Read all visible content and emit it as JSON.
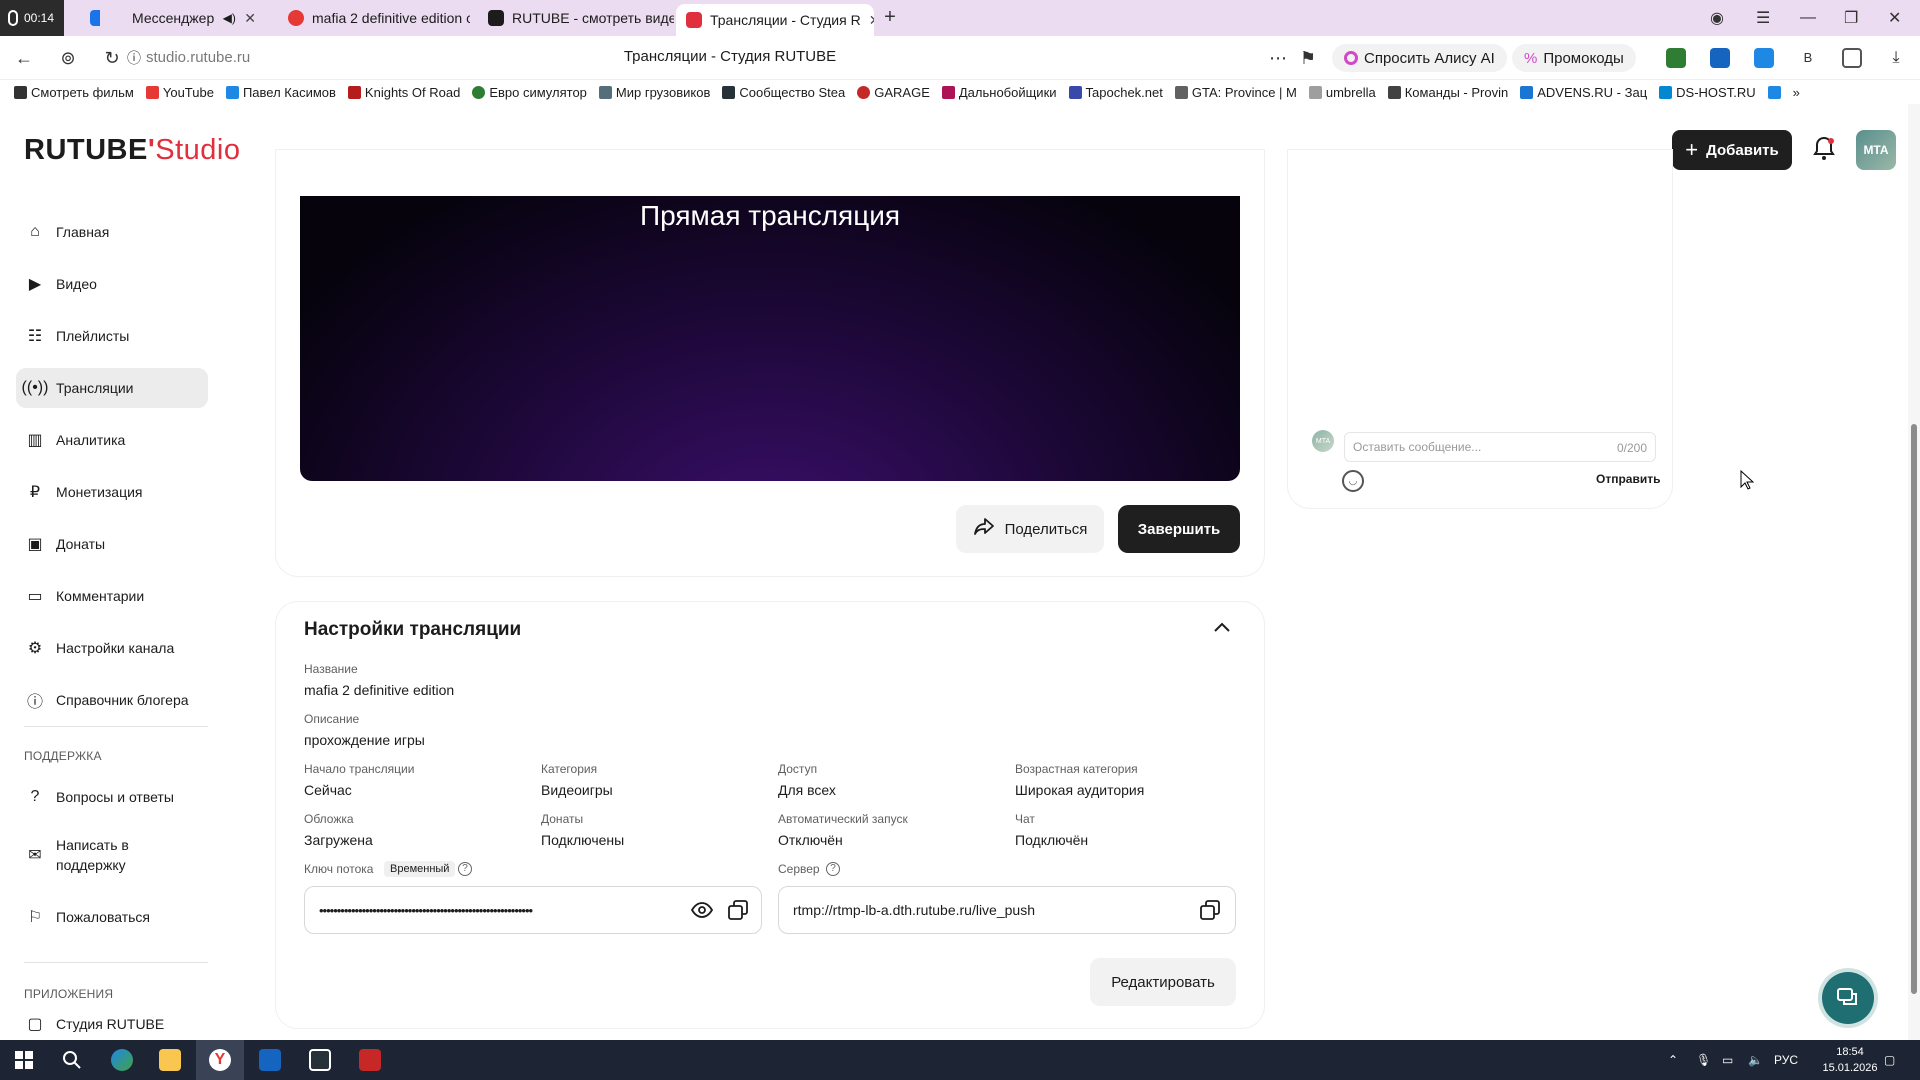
{
  "browser": {
    "rec_time": "00:14",
    "tabs": [
      {
        "label": "Мессенджер",
        "color": "#1a73e8"
      },
      {
        "label": "mafia 2 definitive edition c",
        "color": "#e53935"
      },
      {
        "label": "RUTUBE - смотреть виде",
        "color": "#1c1c1c"
      },
      {
        "label": "Трансляции - Студия R",
        "color": "#e02f3d"
      }
    ],
    "url": "studio.rutube.ru",
    "page_title": "Трансляции - Студия RUTUBE",
    "ask_alice": "Спросить Алису AI",
    "promo": "Промокоды",
    "bookmarks": [
      "Смотреть фильм",
      "YouTube",
      "Павел Касимов",
      "Knights Of Road",
      "Евро симулятор",
      "Мир грузовиков",
      "Сообщество Stea",
      "GARAGE",
      "Дальнобойщики",
      "Tapochek.net",
      "GTA: Province | M",
      "umbrella",
      "Команды - Provin",
      "ADVENS.RU - Зац",
      "DS-HOST.RU"
    ]
  },
  "header": {
    "logo_main": "RUTUBE",
    "logo_studio": "Studio",
    "add_label": "Добавить",
    "avatar_text": "MTA"
  },
  "sidebar": {
    "items": [
      {
        "label": "Главная",
        "icon": "home-icon"
      },
      {
        "label": "Видео",
        "icon": "video-icon"
      },
      {
        "label": "Плейлисты",
        "icon": "playlist-icon"
      },
      {
        "label": "Трансляции",
        "icon": "broadcast-icon"
      },
      {
        "label": "Аналитика",
        "icon": "analytics-icon"
      },
      {
        "label": "Монетизация",
        "icon": "ruble-icon"
      },
      {
        "label": "Донаты",
        "icon": "donate-icon"
      },
      {
        "label": "Комментарии",
        "icon": "comment-icon"
      },
      {
        "label": "Настройки канала",
        "icon": "gear-icon"
      },
      {
        "label": "Справочник блогера",
        "icon": "info-icon"
      }
    ],
    "support_head": "ПОДДЕРЖКА",
    "support_items": [
      {
        "label": "Вопросы и ответы"
      },
      {
        "label": "Написать в поддержку"
      },
      {
        "label": "Пожаловаться"
      }
    ],
    "apps_head": "ПРИЛОЖЕНИЯ",
    "apps_items": [
      {
        "label": "Студия RUTUBE"
      }
    ]
  },
  "stream": {
    "video_title": "Прямая трансляция",
    "share_label": "Поделиться",
    "end_label": "Завершить"
  },
  "chat": {
    "avatar_text": "MTA",
    "placeholder": "Оставить сообщение...",
    "counter": "0/200",
    "send_label": "Отправить"
  },
  "settings": {
    "title": "Настройки трансляции",
    "name_label": "Название",
    "name_value": "mafia 2 definitive edition",
    "desc_label": "Описание",
    "desc_value": "прохождение игры",
    "row1": [
      {
        "label": "Начало трансляции",
        "value": "Сейчас"
      },
      {
        "label": "Категория",
        "value": "Видеоигры"
      },
      {
        "label": "Доступ",
        "value": "Для всех"
      },
      {
        "label": "Возрастная категория",
        "value": "Широкая аудитория"
      }
    ],
    "row2": [
      {
        "label": "Обложка",
        "value": "Загружена"
      },
      {
        "label": "Донаты",
        "value": "Подключены"
      },
      {
        "label": "Автоматический запуск",
        "value": "Отключён"
      },
      {
        "label": "Чат",
        "value": "Подключён"
      }
    ],
    "key_label": "Ключ потока",
    "key_badge": "Временный",
    "key_value": "••••••••••••••••••••••••••••••••••••••••••••••••••••••••••••",
    "server_label": "Сервер",
    "server_value": "rtmp://rtmp-lb-a.dth.rutube.ru/live_push",
    "edit_label": "Редактировать"
  },
  "taskbar": {
    "lang": "РУС",
    "time": "18:54",
    "date": "15.01.2026"
  }
}
